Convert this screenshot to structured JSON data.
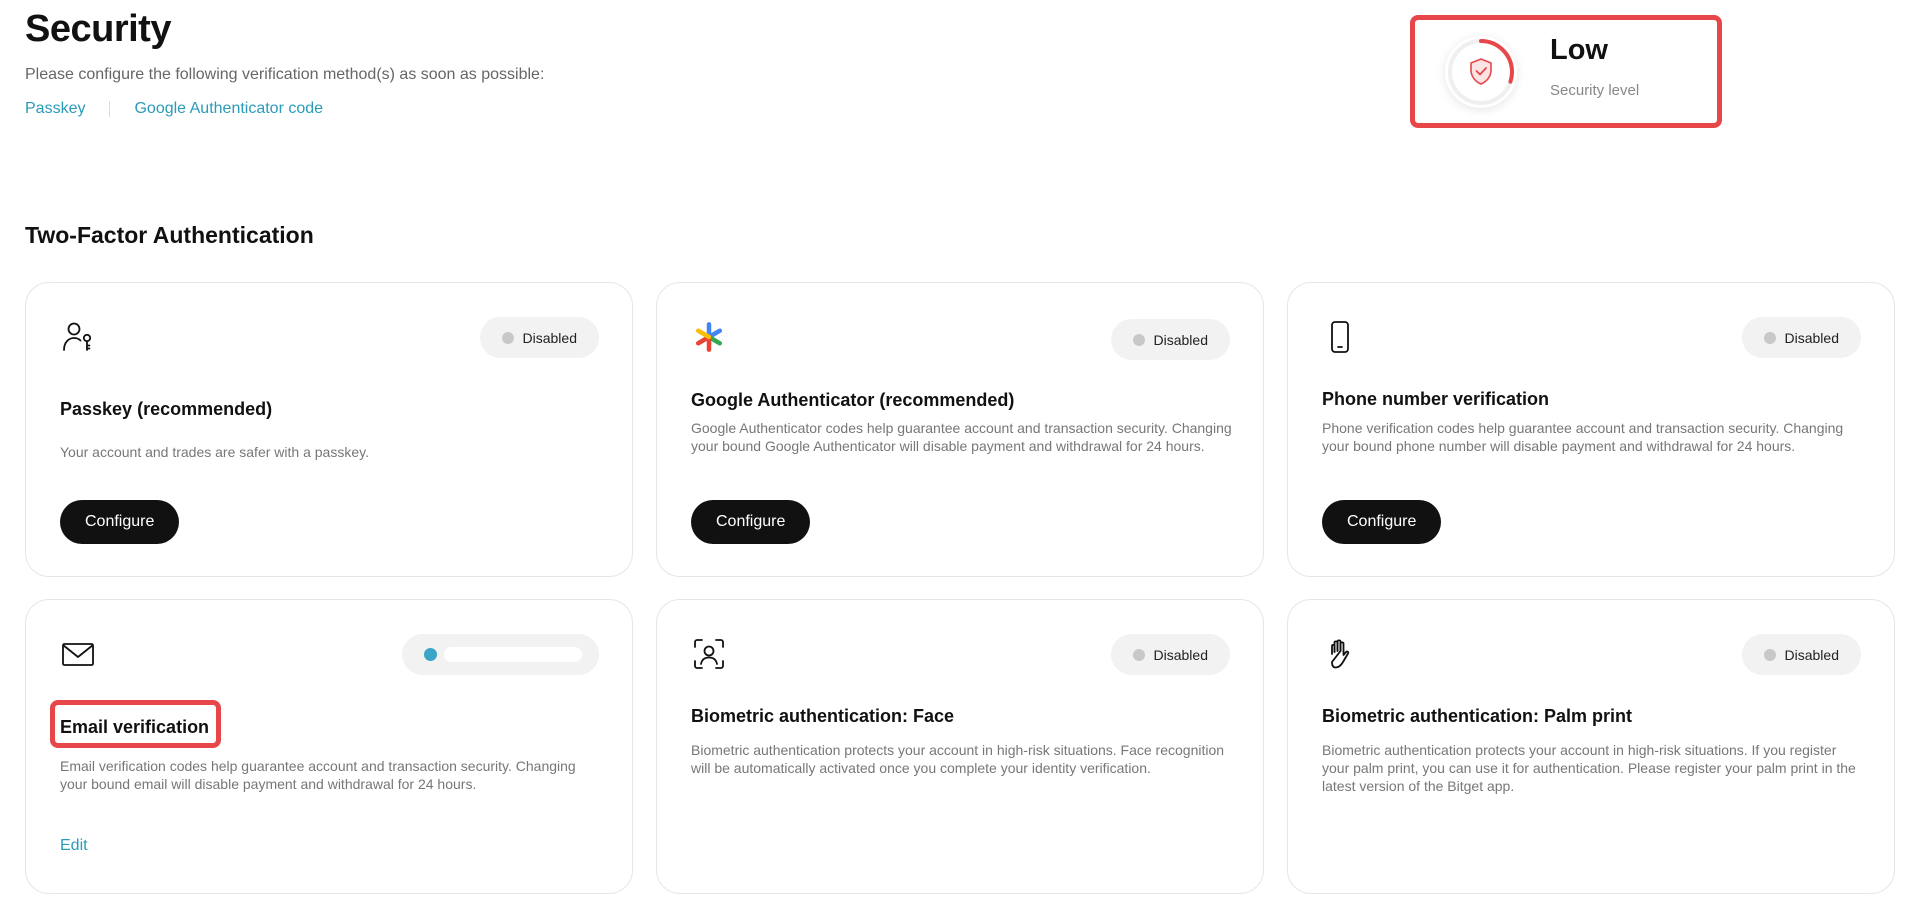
{
  "header": {
    "title": "Security",
    "subtitle": "Please configure the following verification method(s) as soon as possible:",
    "links": [
      "Passkey",
      "Google Authenticator code"
    ]
  },
  "security_level": {
    "value": "Low",
    "caption": "Security level",
    "ring_fraction": 0.3,
    "ring_color": "#e8474a"
  },
  "section": {
    "title": "Two-Factor Authentication"
  },
  "cards": [
    {
      "icon": "user-key-icon",
      "status": "Disabled",
      "title": "Passkey (recommended)",
      "description": "Your account and trades are safer with a passkey.",
      "action": "Configure"
    },
    {
      "icon": "google-authenticator-icon",
      "status": "Disabled",
      "title": "Google Authenticator (recommended)",
      "description": "Google Authenticator codes help guarantee account and transaction security. Changing your bound Google Authenticator will disable payment and withdrawal for 24 hours.",
      "action": "Configure"
    },
    {
      "icon": "phone-icon",
      "status": "Disabled",
      "title": "Phone number verification",
      "description": "Phone verification codes help guarantee account and transaction security. Changing your bound phone number will disable payment and withdrawal for 24 hours.",
      "action": "Configure"
    },
    {
      "icon": "mail-icon",
      "status": "",
      "title": "Email verification",
      "description": "Email verification codes help guarantee account and transaction security. Changing your bound email will disable payment and withdrawal for 24 hours.",
      "action": "Edit"
    },
    {
      "icon": "face-scan-icon",
      "status": "Disabled",
      "title": "Biometric authentication: Face",
      "description": "Biometric authentication protects your account in high-risk situations. Face recognition will be automatically activated once you complete your identity verification."
    },
    {
      "icon": "palm-icon",
      "status": "Disabled",
      "title": "Biometric authentication: Palm print",
      "description": "Biometric authentication protects your account in high-risk situations. If you register your palm print, you can use it for authentication. Please register your palm print in the latest version of the Bitget app."
    }
  ],
  "colors": {
    "accent_link": "#2a9bb8",
    "highlight": "#e8474a",
    "enabled_dot": "#3aa5c7"
  }
}
